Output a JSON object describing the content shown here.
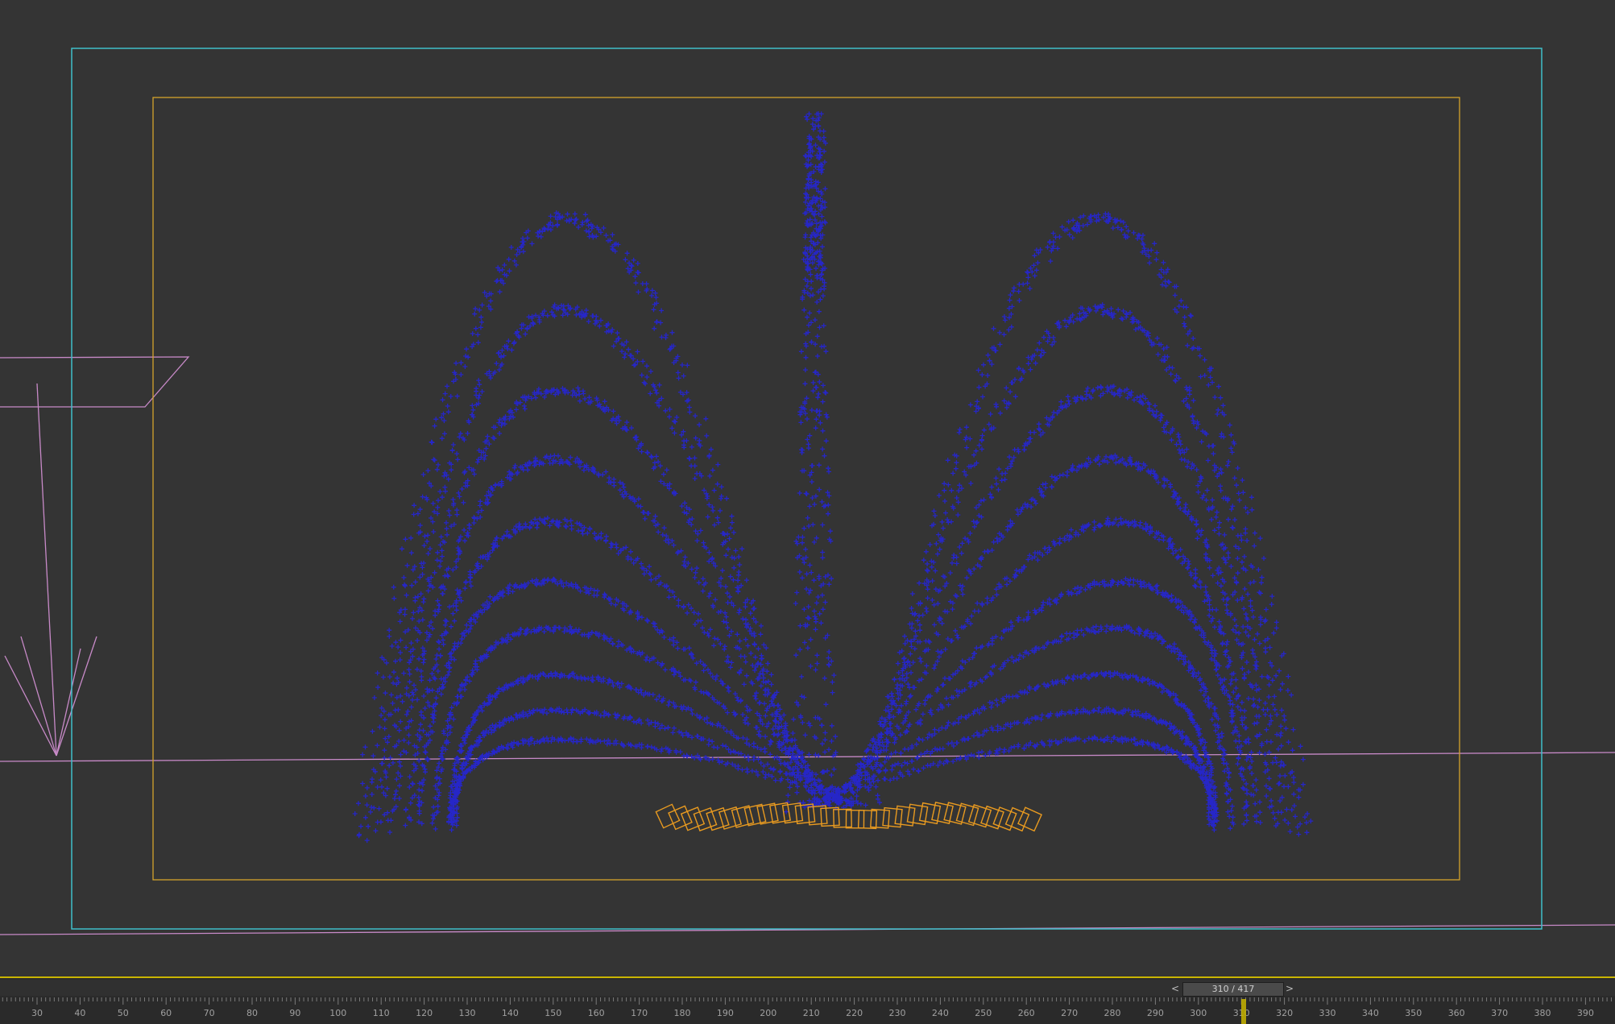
{
  "viewport": {
    "colors": {
      "background": "#343434",
      "safe_frame_outer": "#3fbfca",
      "safe_frame_inner": "#d4a32c",
      "particles": "#2626c8",
      "emitter_boxes": "#e89a20",
      "helper_lines": "#c88ac8"
    },
    "icons": [
      "particle-spray",
      "emitter-box",
      "light-helper"
    ]
  },
  "timeline": {
    "frame_slider_text": "310 / 417",
    "prev_label": "<",
    "next_label": ">",
    "current_frame": 310,
    "total_frames": 417,
    "tick_labels": [
      "30",
      "40",
      "50",
      "60",
      "70",
      "80",
      "90",
      "100",
      "110",
      "120",
      "130",
      "140",
      "150",
      "160",
      "170",
      "180",
      "190",
      "200",
      "210",
      "220",
      "230",
      "240",
      "250",
      "260",
      "270",
      "280",
      "290",
      "300",
      "310",
      "320",
      "330",
      "340",
      "350",
      "360",
      "370",
      "380",
      "390"
    ],
    "colors": {
      "accent": "#c8b400",
      "ruler_text": "#a0a0a0"
    }
  }
}
